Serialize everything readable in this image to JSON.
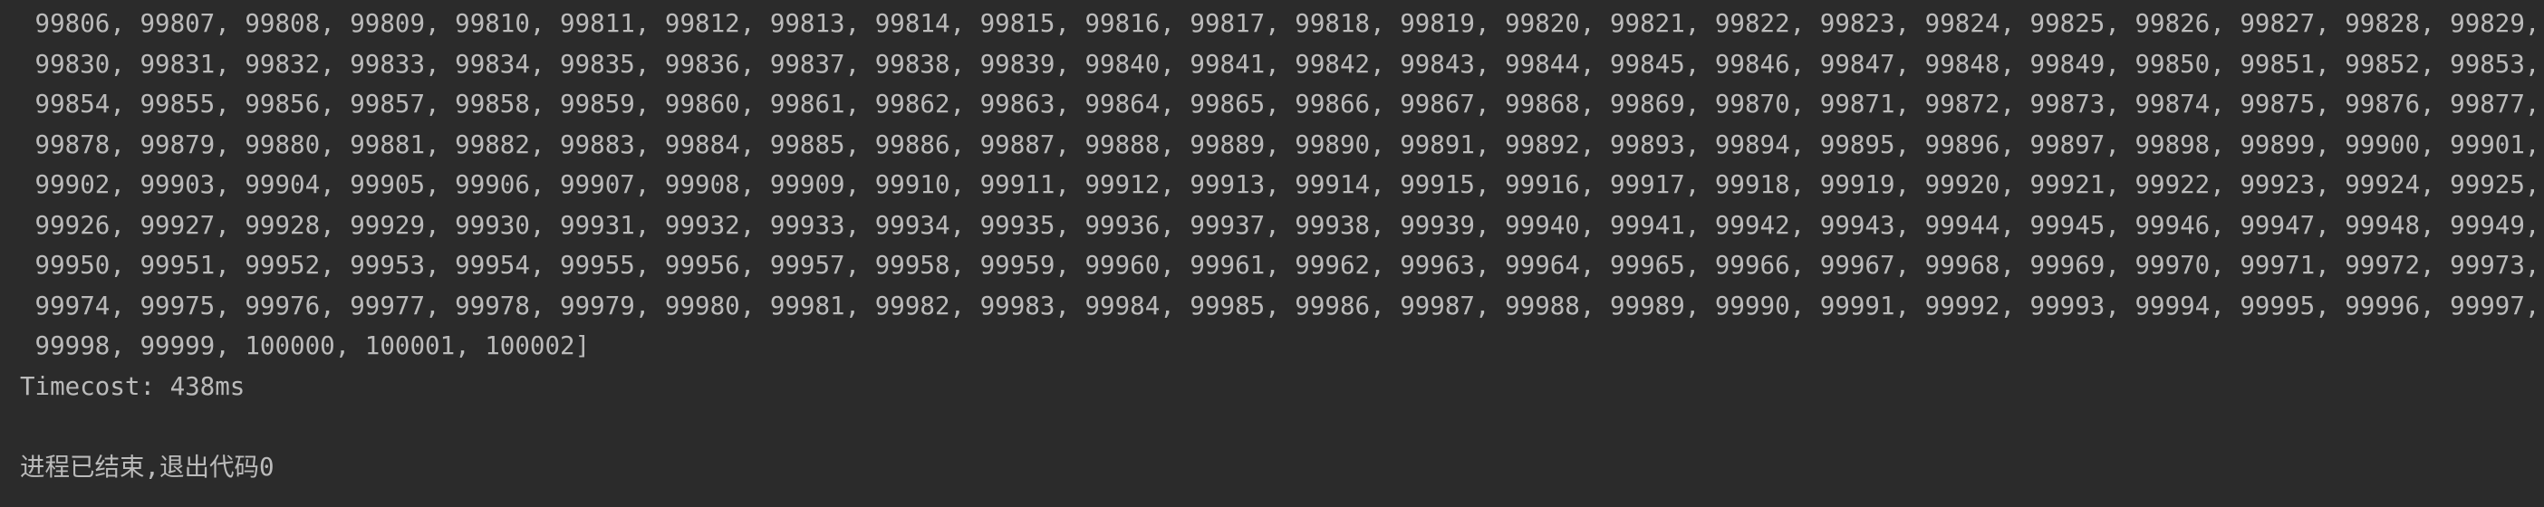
{
  "console": {
    "output_lines": [
      " 99806, 99807, 99808, 99809, 99810, 99811, 99812, 99813, 99814, 99815, 99816, 99817, 99818, 99819, 99820, 99821, 99822, 99823, 99824, 99825, 99826, 99827, 99828, 99829,",
      " 99830, 99831, 99832, 99833, 99834, 99835, 99836, 99837, 99838, 99839, 99840, 99841, 99842, 99843, 99844, 99845, 99846, 99847, 99848, 99849, 99850, 99851, 99852, 99853,",
      " 99854, 99855, 99856, 99857, 99858, 99859, 99860, 99861, 99862, 99863, 99864, 99865, 99866, 99867, 99868, 99869, 99870, 99871, 99872, 99873, 99874, 99875, 99876, 99877,",
      " 99878, 99879, 99880, 99881, 99882, 99883, 99884, 99885, 99886, 99887, 99888, 99889, 99890, 99891, 99892, 99893, 99894, 99895, 99896, 99897, 99898, 99899, 99900, 99901,",
      " 99902, 99903, 99904, 99905, 99906, 99907, 99908, 99909, 99910, 99911, 99912, 99913, 99914, 99915, 99916, 99917, 99918, 99919, 99920, 99921, 99922, 99923, 99924, 99925,",
      " 99926, 99927, 99928, 99929, 99930, 99931, 99932, 99933, 99934, 99935, 99936, 99937, 99938, 99939, 99940, 99941, 99942, 99943, 99944, 99945, 99946, 99947, 99948, 99949,",
      " 99950, 99951, 99952, 99953, 99954, 99955, 99956, 99957, 99958, 99959, 99960, 99961, 99962, 99963, 99964, 99965, 99966, 99967, 99968, 99969, 99970, 99971, 99972, 99973,",
      " 99974, 99975, 99976, 99977, 99978, 99979, 99980, 99981, 99982, 99983, 99984, 99985, 99986, 99987, 99988, 99989, 99990, 99991, 99992, 99993, 99994, 99995, 99996, 99997,",
      " 99998, 99999, 100000, 100001, 100002]"
    ],
    "timecost": "Timecost: 438ms",
    "exit_message": "进程已结束,退出代码0"
  },
  "colors": {
    "background": "#2b2b2b",
    "text": "#bbbbbb"
  }
}
